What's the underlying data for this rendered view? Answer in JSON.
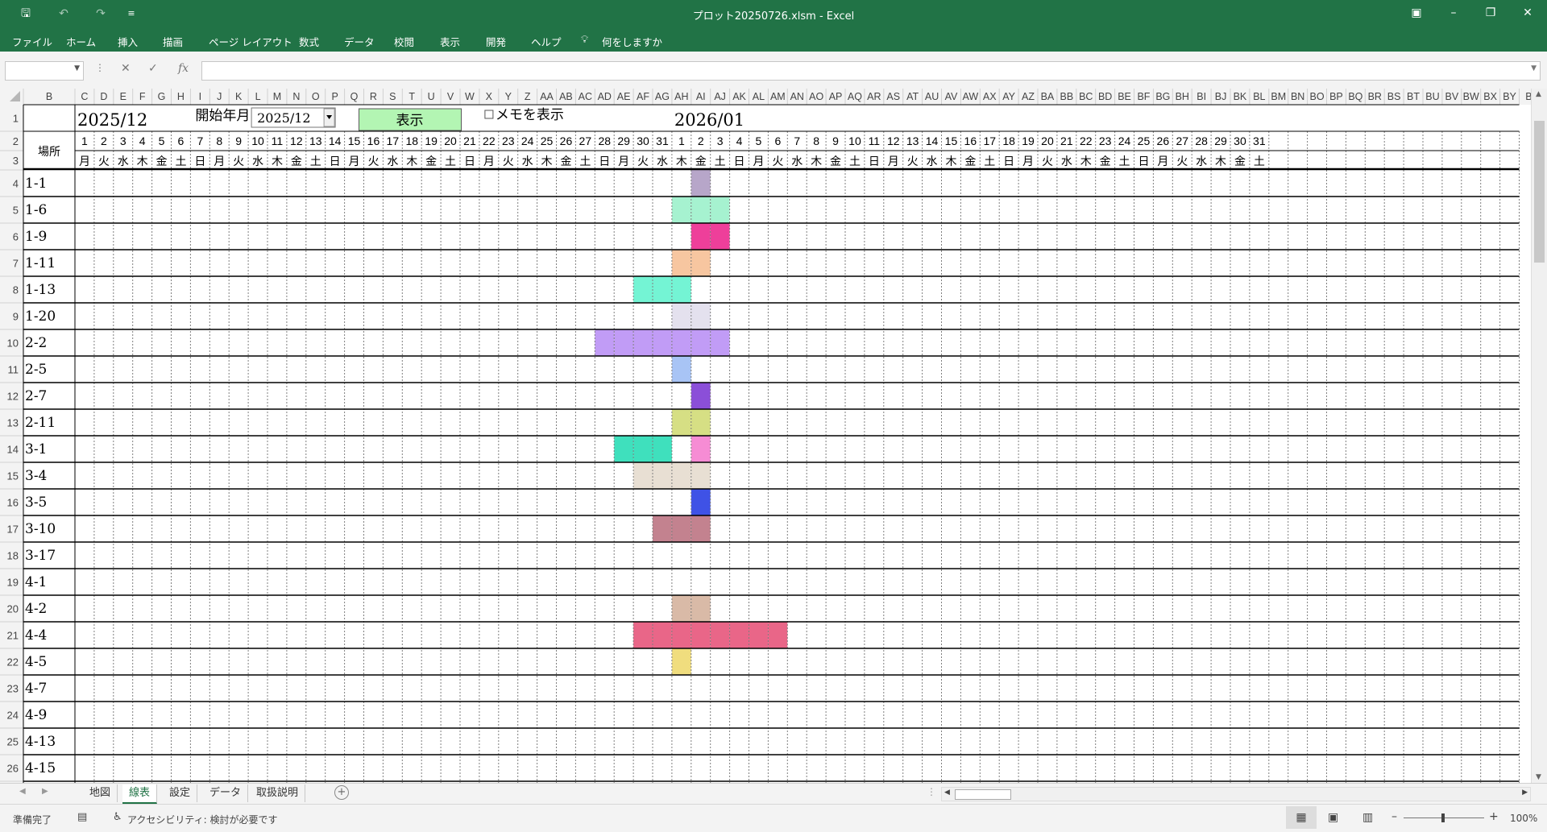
{
  "window": {
    "title": "プロット20250726.xlsm  -  Excel",
    "quick_access": [
      "save-icon",
      "undo-icon",
      "redo-icon",
      "customize-icon"
    ]
  },
  "ribbon": {
    "tabs": [
      "ファイル",
      "ホーム",
      "挿入",
      "描画",
      "ページ レイアウト",
      "数式",
      "データ",
      "校閲",
      "表示",
      "開発",
      "ヘルプ"
    ],
    "tell_me": "何をしますか"
  },
  "formula_bar": {
    "name_box": "",
    "fx_label": "fx",
    "content": ""
  },
  "sheet": {
    "columns": [
      "B",
      "C",
      "D",
      "E",
      "F",
      "G",
      "H",
      "I",
      "J",
      "K",
      "L",
      "M",
      "N",
      "O",
      "P",
      "Q",
      "R",
      "S",
      "T",
      "U",
      "V",
      "W",
      "X",
      "Y",
      "Z",
      "AA",
      "AB",
      "AC",
      "AD",
      "AE",
      "AF",
      "AG",
      "AH",
      "AI",
      "AJ",
      "AK",
      "AL",
      "AM",
      "AN",
      "AO",
      "AP",
      "AQ",
      "AR",
      "AS",
      "AT",
      "AU",
      "AV",
      "AW",
      "AX",
      "AY",
      "AZ",
      "BA",
      "BB",
      "BC",
      "BD",
      "BE",
      "BF",
      "BG",
      "BH",
      "BI",
      "BJ",
      "BK",
      "BL",
      "BM",
      "BN",
      "BO",
      "BP",
      "BQ",
      "BR",
      "BS",
      "BT",
      "BU",
      "BV",
      "BW",
      "BX",
      "BY",
      "B"
    ],
    "row_numbers": [
      "1",
      "2",
      "3",
      "4",
      "5",
      "6",
      "7",
      "8",
      "9",
      "10",
      "11",
      "12",
      "13",
      "14",
      "15",
      "16",
      "17",
      "18",
      "19",
      "20",
      "21",
      "22",
      "23",
      "24",
      "25",
      "26"
    ],
    "month1": "2025/12",
    "month2": "2026/01",
    "start_label": "開始年月",
    "start_value": "2025/12",
    "show_button": "表示",
    "memo_checkbox": "メモを表示",
    "place_header": "場所",
    "days": [
      "1",
      "2",
      "3",
      "4",
      "5",
      "6",
      "7",
      "8",
      "9",
      "10",
      "11",
      "12",
      "13",
      "14",
      "15",
      "16",
      "17",
      "18",
      "19",
      "20",
      "21",
      "22",
      "23",
      "24",
      "25",
      "26",
      "27",
      "28",
      "29",
      "30",
      "31",
      "1",
      "2",
      "3",
      "4",
      "5",
      "6",
      "7",
      "8",
      "9",
      "10",
      "11",
      "12",
      "13",
      "14",
      "15",
      "16",
      "17",
      "18",
      "19",
      "20",
      "21",
      "22",
      "23",
      "24",
      "25",
      "26",
      "27",
      "28",
      "29",
      "30",
      "31"
    ],
    "weekdays": [
      "月",
      "火",
      "水",
      "木",
      "金",
      "土",
      "日",
      "月",
      "火",
      "水",
      "木",
      "金",
      "土",
      "日",
      "月",
      "火",
      "水",
      "木",
      "金",
      "土",
      "日",
      "月",
      "火",
      "水",
      "木",
      "金",
      "土",
      "日",
      "月",
      "火",
      "水",
      "木",
      "金",
      "土",
      "日",
      "月",
      "火",
      "水",
      "木",
      "金",
      "土",
      "日",
      "月",
      "火",
      "水",
      "木",
      "金",
      "土",
      "日",
      "月",
      "火",
      "水",
      "木",
      "金",
      "土",
      "日",
      "月",
      "火",
      "水",
      "木",
      "金",
      "土"
    ],
    "places": [
      "1-1",
      "1-6",
      "1-9",
      "1-11",
      "1-13",
      "1-20",
      "2-2",
      "2-5",
      "2-7",
      "2-11",
      "3-1",
      "3-4",
      "3-5",
      "3-10",
      "3-17",
      "4-1",
      "4-2",
      "4-4",
      "4-5",
      "4-7",
      "4-9",
      "4-13",
      "4-15"
    ],
    "fills": [
      {
        "place": "1-1",
        "cells": [
          {
            "day": "1/02",
            "color": "#b7a6c9"
          }
        ]
      },
      {
        "place": "1-6",
        "cells": [
          {
            "day": "1/01",
            "color": "#a6f2d0"
          },
          {
            "day": "1/02",
            "color": "#a6f2d0"
          },
          {
            "day": "1/03",
            "color": "#a6f2d0"
          }
        ]
      },
      {
        "place": "1-9",
        "cells": [
          {
            "day": "1/02",
            "color": "#ee3f9a"
          },
          {
            "day": "1/03",
            "color": "#ee3f9a"
          }
        ]
      },
      {
        "place": "1-11",
        "cells": [
          {
            "day": "1/01",
            "color": "#f7c6a0"
          },
          {
            "day": "1/02",
            "color": "#f7c6a0"
          }
        ]
      },
      {
        "place": "1-13",
        "cells": [
          {
            "day": "12/30",
            "color": "#74f4d4"
          },
          {
            "day": "12/31",
            "color": "#74f4d4"
          },
          {
            "day": "1/01",
            "color": "#74f4d4"
          }
        ]
      },
      {
        "place": "1-20",
        "cells": [
          {
            "day": "1/01",
            "color": "#e4e1ee"
          },
          {
            "day": "1/02",
            "color": "#e4e1ee"
          }
        ]
      },
      {
        "place": "2-2",
        "cells": [
          {
            "day": "12/28",
            "color": "#c19cf6"
          },
          {
            "day": "12/29",
            "color": "#c19cf6"
          },
          {
            "day": "12/30",
            "color": "#c19cf6"
          },
          {
            "day": "12/31",
            "color": "#c19cf6"
          },
          {
            "day": "1/01",
            "color": "#c19cf6"
          },
          {
            "day": "1/02",
            "color": "#c19cf6"
          },
          {
            "day": "1/03",
            "color": "#c19cf6"
          }
        ]
      },
      {
        "place": "2-5",
        "cells": [
          {
            "day": "1/01",
            "color": "#a8c4f5"
          }
        ]
      },
      {
        "place": "2-7",
        "cells": [
          {
            "day": "1/02",
            "color": "#8b4fd8"
          }
        ]
      },
      {
        "place": "2-11",
        "cells": [
          {
            "day": "1/01",
            "color": "#d6df84"
          },
          {
            "day": "1/02",
            "color": "#d6df84"
          }
        ]
      },
      {
        "place": "3-1",
        "cells": [
          {
            "day": "12/29",
            "color": "#3fe0bd"
          },
          {
            "day": "12/30",
            "color": "#3fe0bd"
          },
          {
            "day": "12/31",
            "color": "#3fe0bd"
          },
          {
            "day": "1/02",
            "color": "#f68cd4"
          }
        ]
      },
      {
        "place": "3-4",
        "cells": [
          {
            "day": "12/30",
            "color": "#e8dfd3"
          },
          {
            "day": "12/31",
            "color": "#e8dfd3"
          },
          {
            "day": "1/01",
            "color": "#e8dfd3"
          },
          {
            "day": "1/02",
            "color": "#e8dfd3"
          }
        ]
      },
      {
        "place": "3-5",
        "cells": [
          {
            "day": "1/02",
            "color": "#3f52e6"
          }
        ]
      },
      {
        "place": "3-10",
        "cells": [
          {
            "day": "12/31",
            "color": "#c3828f"
          },
          {
            "day": "1/01",
            "color": "#c3828f"
          },
          {
            "day": "1/02",
            "color": "#c3828f"
          }
        ]
      },
      {
        "place": "4-2",
        "cells": [
          {
            "day": "1/01",
            "color": "#d9baa7"
          },
          {
            "day": "1/02",
            "color": "#d9baa7"
          }
        ]
      },
      {
        "place": "4-4",
        "cells": [
          {
            "day": "12/30",
            "color": "#e96688"
          },
          {
            "day": "12/31",
            "color": "#e96688"
          },
          {
            "day": "1/01",
            "color": "#e96688"
          },
          {
            "day": "1/02",
            "color": "#e96688"
          },
          {
            "day": "1/03",
            "color": "#e96688"
          },
          {
            "day": "1/04",
            "color": "#e96688"
          },
          {
            "day": "1/05",
            "color": "#e96688"
          },
          {
            "day": "1/06",
            "color": "#e96688"
          }
        ]
      },
      {
        "place": "4-5",
        "cells": [
          {
            "day": "1/01",
            "color": "#f0dd7e"
          }
        ]
      }
    ]
  },
  "sheet_tabs": [
    "地図",
    "線表",
    "設定",
    "データ",
    "取扱説明"
  ],
  "active_sheet": "線表",
  "status": {
    "ready": "準備完了",
    "accessibility": "アクセシビリティ: 検討が必要です",
    "zoom": "100%"
  },
  "colors": {
    "excel_green": "#217346"
  }
}
